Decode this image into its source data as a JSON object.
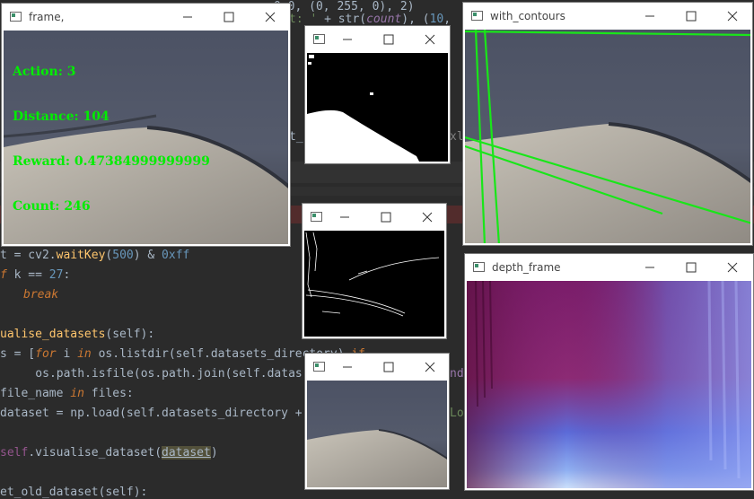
{
  "windows": {
    "frame": {
      "title": "frame,"
    },
    "mask": {
      "title": ""
    },
    "edges": {
      "title": ""
    },
    "small": {
      "title": ""
    },
    "contours": {
      "title": "with_contours"
    },
    "depth": {
      "title": "depth_frame"
    }
  },
  "overlay": {
    "action": "Action: 3",
    "distance": "Distance: 104",
    "reward": "Reward: 0.47384999999999",
    "count": "Count: 246"
  },
  "code": {
    "l0": "0.0, (0, 255, 0), 2)",
    "l1": "t: ' + str(count), (10, ",
    "l2": "t_",
    "l3": "xl",
    "waitkey_pre": "t = cv2.",
    "waitkey_fn": "waitKey",
    "waitkey_open": "(",
    "waitkey_num": "500",
    "waitkey_mid": ") & ",
    "waitkey_hex": "0xff",
    "if_kw": "f",
    "if_mid": " k == ",
    "if_num": "27",
    "if_end": ":",
    "break_kw": "break",
    "vis_def_fn": "ualise_datasets",
    "vis_def_rest": "(self):",
    "files_pre": "s = [",
    "files_for": "for",
    "files_mid1": " i ",
    "files_in": "in",
    "files_mid2": " os.listdir(self.datasets_directory) ",
    "files_if": "if",
    "isfile_line": "    os.path.isfile(os.path.join(self.datas",
    "isfile_tail": "nd",
    "for_pre": "file_name ",
    "for_in": "in",
    "for_post": " files:",
    "load_line": "dataset = np.load(self.datasets_directory + ",
    "load_tail": "Lo",
    "self_pre": "self",
    "vis_call_mid": ".visualise_dataset(",
    "vis_call_arg": "dataset",
    "vis_call_end": ")",
    "old_line": "et_old_dataset(self):"
  }
}
